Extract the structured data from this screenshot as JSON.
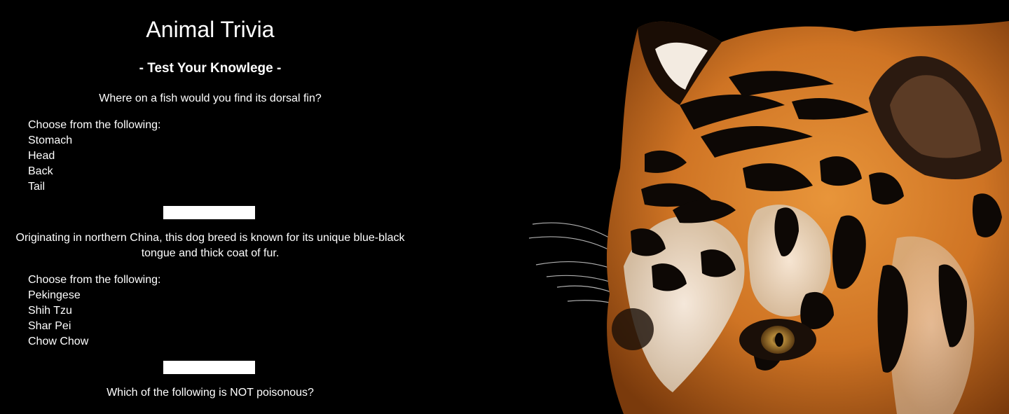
{
  "header": {
    "title": "Animal Trivia",
    "subtitle": "- Test Your Knowlege -"
  },
  "questions": [
    {
      "text": "Where on a fish would you find its dorsal fin?",
      "prompt": "Choose from the following:",
      "choices": [
        "Stomach",
        "Head",
        "Back",
        "Tail"
      ],
      "answer_value": ""
    },
    {
      "text_line1": "Originating in northern China, this dog breed is known for its unique blue-black",
      "text_line2": "tongue and thick coat of fur.",
      "prompt": "Choose from the following:",
      "choices": [
        "Pekingese",
        "Shih Tzu",
        "Shar Pei",
        "Chow Chow"
      ],
      "answer_value": ""
    },
    {
      "text": "Which of the following is NOT poisonous?"
    }
  ],
  "image": {
    "subject": "tiger-face",
    "colors": {
      "background": "#000000",
      "fur_orange": "#d9822b",
      "fur_dark_orange": "#a85412",
      "fur_white": "#f1ebe3",
      "stripe": "#0d0805",
      "eye": "#c79a3a"
    }
  }
}
